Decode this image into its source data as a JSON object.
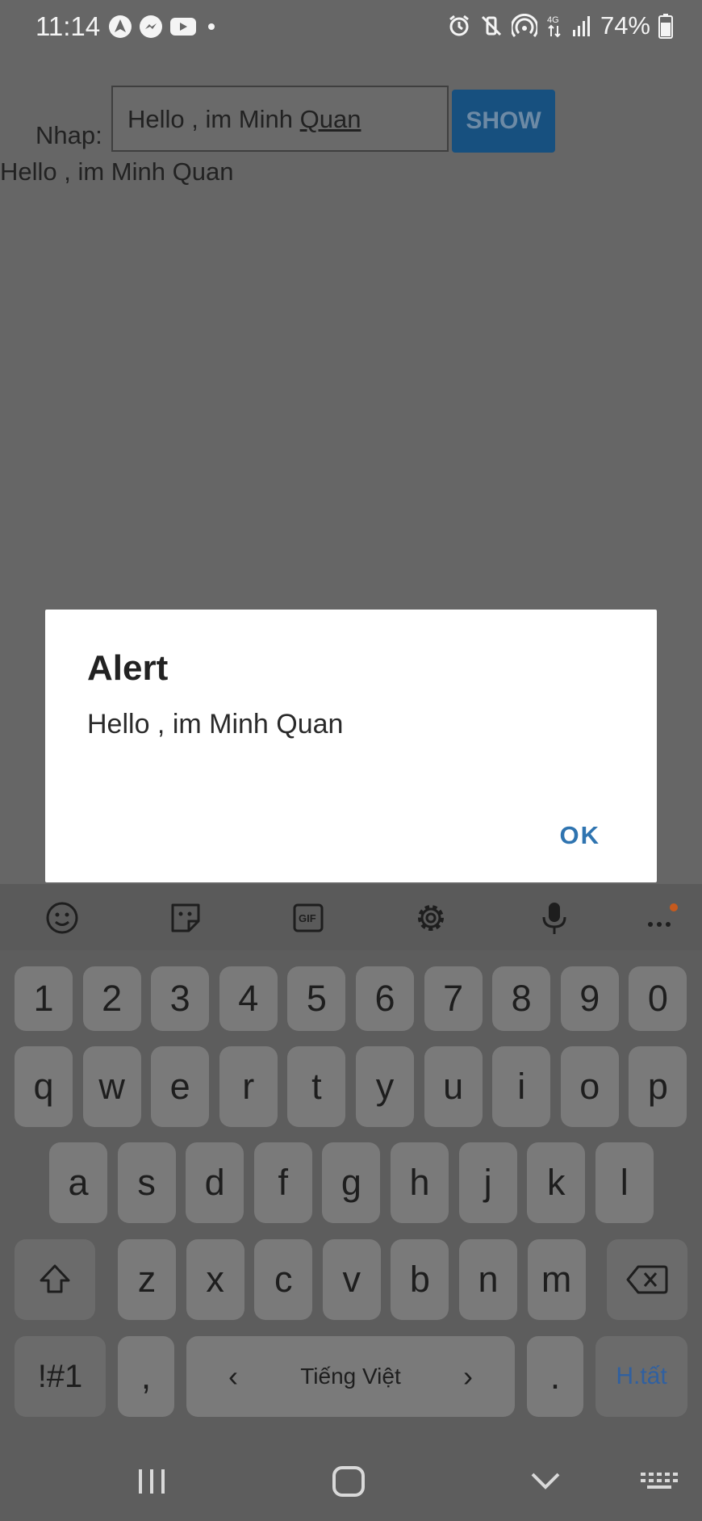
{
  "status_bar": {
    "time": "11:14",
    "left_icons": [
      "navigation-app-icon",
      "messenger-icon",
      "youtube-icon",
      "dot-icon"
    ],
    "right_icons": [
      "alarm-icon",
      "vibrate-mute-icon",
      "hotspot-icon",
      "4g-data-icon",
      "signal-icon"
    ],
    "battery_text": "74%",
    "battery_level": 0.74
  },
  "app": {
    "input_label": "Nhap:",
    "input_value_prefix": "Hello , im Minh ",
    "input_value_underlined": "Quan",
    "show_button_label": "SHOW",
    "output_text": "Hello , im Minh Quan"
  },
  "dialog": {
    "title": "Alert",
    "message": "Hello , im Minh Quan",
    "ok_label": "OK"
  },
  "keyboard": {
    "toolbar_icons": [
      "emoji-icon",
      "sticker-icon",
      "gif-icon",
      "settings-icon",
      "microphone-icon",
      "more-icon"
    ],
    "row_numbers": [
      "1",
      "2",
      "3",
      "4",
      "5",
      "6",
      "7",
      "8",
      "9",
      "0"
    ],
    "row_top": [
      "q",
      "w",
      "e",
      "r",
      "t",
      "y",
      "u",
      "i",
      "o",
      "p"
    ],
    "row_middle": [
      "a",
      "s",
      "d",
      "f",
      "g",
      "h",
      "j",
      "k",
      "l"
    ],
    "row_bottom": [
      "z",
      "x",
      "c",
      "v",
      "b",
      "n",
      "m"
    ],
    "symbols_label": "!#1",
    "comma_label": ",",
    "space_label": "Tiếng Việt",
    "space_left_arrow": "‹",
    "space_right_arrow": "›",
    "period_label": ".",
    "enter_label": "H.tất"
  },
  "navigation_bar": {
    "buttons": [
      "recent-apps-icon",
      "home-icon",
      "back-icon",
      "keyboard-switch-icon"
    ]
  },
  "colors": {
    "dim_background": "#666666",
    "show_button": "#17507f",
    "accent": "#2f74b0",
    "keyboard_key": "#7a7a7a"
  }
}
